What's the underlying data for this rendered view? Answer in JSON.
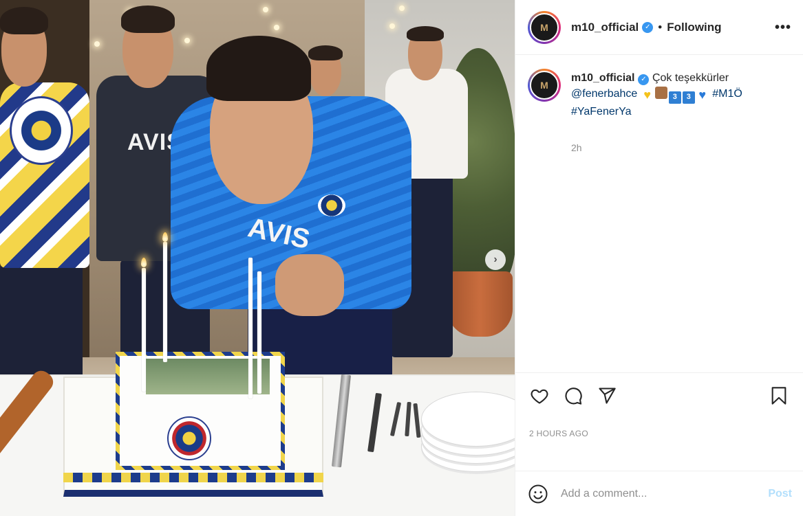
{
  "post": {
    "username": "m10_official",
    "verified_mark": "✓",
    "separator": "•",
    "follow_status": "Following",
    "more_label": "•••"
  },
  "photo": {
    "avis_text": "AVIS",
    "next_arrow": "›",
    "description_icons": [
      "fenerbahce-crest",
      "birthday-cake",
      "candle"
    ]
  },
  "caption": {
    "username": "m10_official",
    "text_1": "Çok teşekkürler",
    "mention": "@fenerbahce",
    "emoji_three_a": "3",
    "emoji_three_b": "3",
    "hashtag_1": "#M1Ö",
    "hashtag_2": "#YaFenerYa",
    "time": "2h"
  },
  "actions": {
    "icons": [
      "heart-icon",
      "comment-icon",
      "share-icon",
      "bookmark-icon"
    ]
  },
  "date_label": "2 HOURS AGO",
  "comment_box": {
    "placeholder": "Add a comment...",
    "post_label": "Post"
  },
  "colors": {
    "verified": "#3897f0",
    "link": "#00376b",
    "post_button": "#b2dffc",
    "muted": "#8e8e8e"
  }
}
